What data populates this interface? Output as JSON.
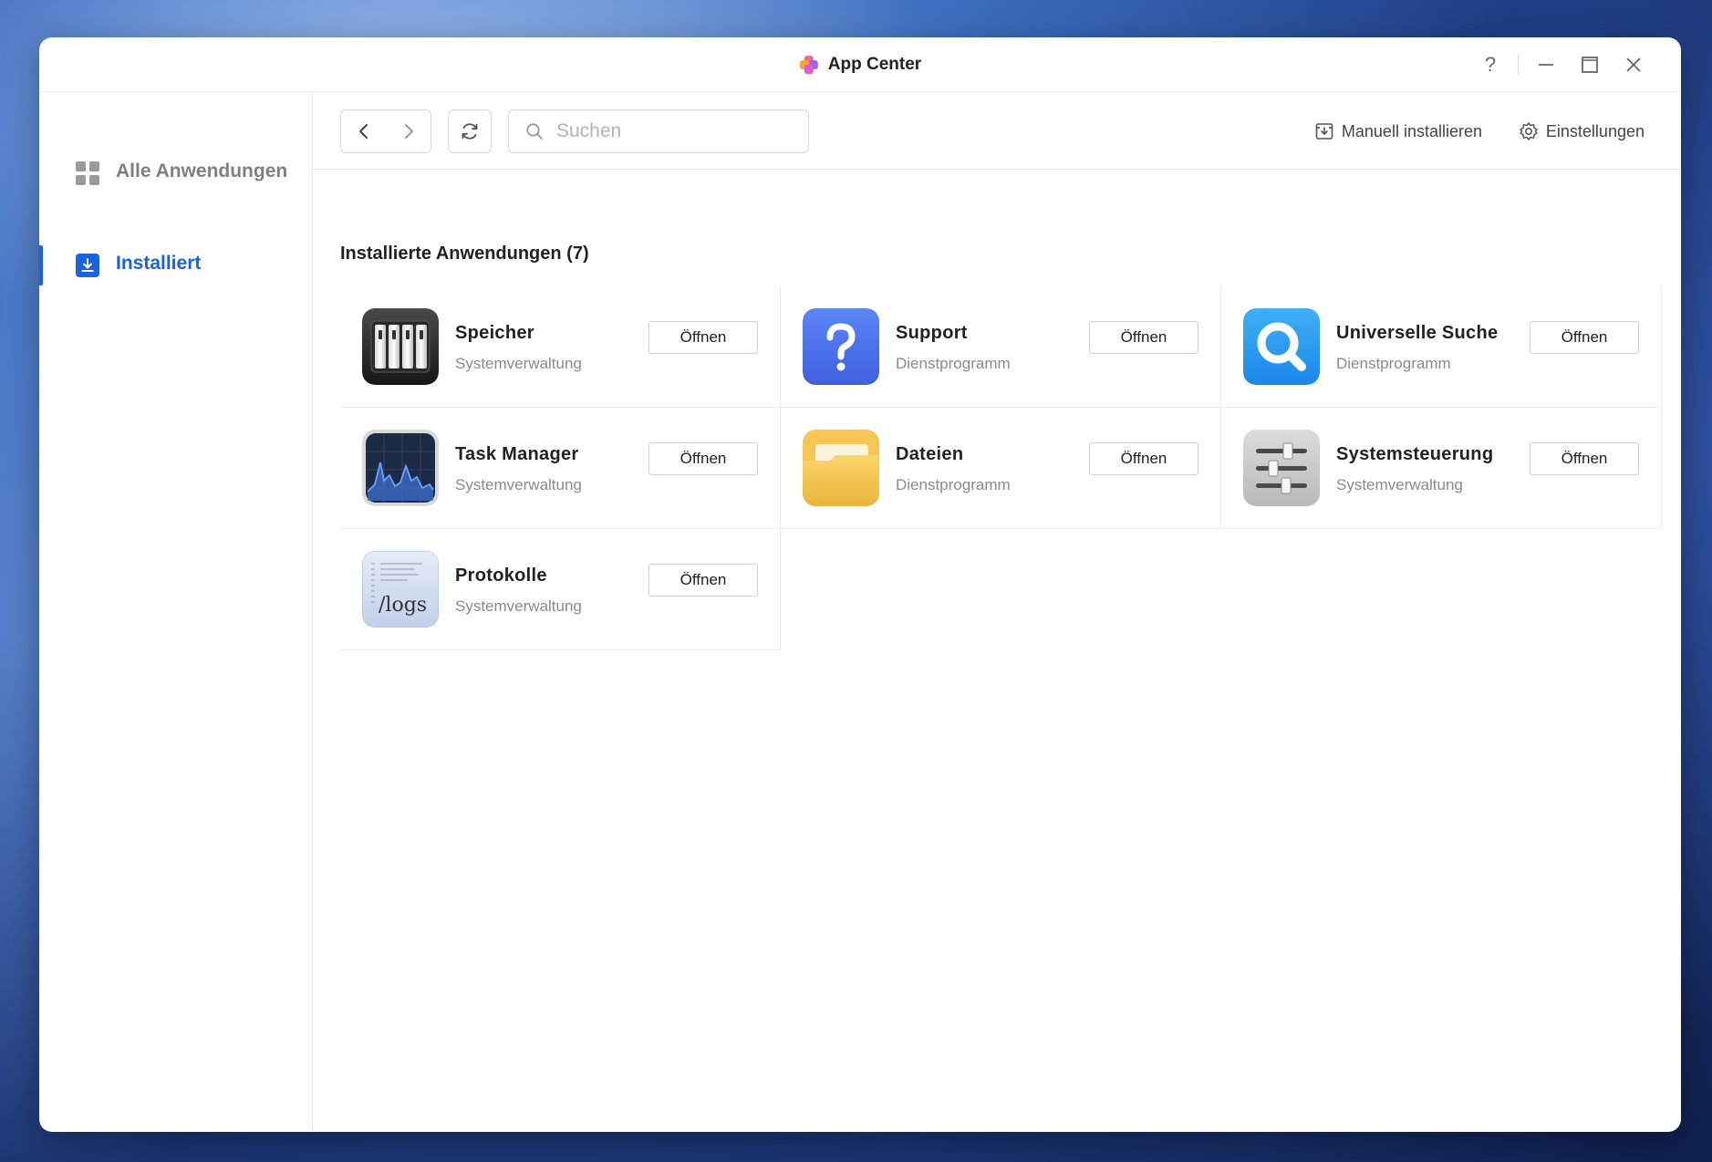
{
  "window": {
    "title": "App Center",
    "controls": {
      "help": "?",
      "minimize": "—",
      "maximize": "☐",
      "close": "✕"
    }
  },
  "sidebar": {
    "items": [
      {
        "label": "Alle Anwendungen",
        "icon": "grid-icon",
        "active": false
      },
      {
        "label": "Installiert",
        "icon": "download-icon",
        "active": true
      }
    ]
  },
  "toolbar": {
    "search_placeholder": "Suchen",
    "manual_install_label": "Manuell installieren",
    "settings_label": "Einstellungen"
  },
  "section": {
    "title": "Installierte Anwendungen (7)"
  },
  "apps": [
    {
      "name": "Speicher",
      "category": "Systemverwaltung",
      "button": "Öffnen",
      "icon": "storage-icon"
    },
    {
      "name": "Support",
      "category": "Dienstprogramm",
      "button": "Öffnen",
      "icon": "support-question-icon"
    },
    {
      "name": "Universelle Suche",
      "category": "Dienstprogramm",
      "button": "Öffnen",
      "icon": "magnifier-icon"
    },
    {
      "name": "Task Manager",
      "category": "Systemverwaltung",
      "button": "Öffnen",
      "icon": "activity-graph-icon"
    },
    {
      "name": "Dateien",
      "category": "Dienstprogramm",
      "button": "Öffnen",
      "icon": "folder-icon"
    },
    {
      "name": "Systemsteuerung",
      "category": "Systemverwaltung",
      "button": "Öffnen",
      "icon": "sliders-icon"
    },
    {
      "name": "Protokolle",
      "category": "Systemverwaltung",
      "button": "Öffnen",
      "icon": "logs-icon",
      "icon_text": "/logs"
    }
  ],
  "colors": {
    "accent": "#1a63e0"
  }
}
